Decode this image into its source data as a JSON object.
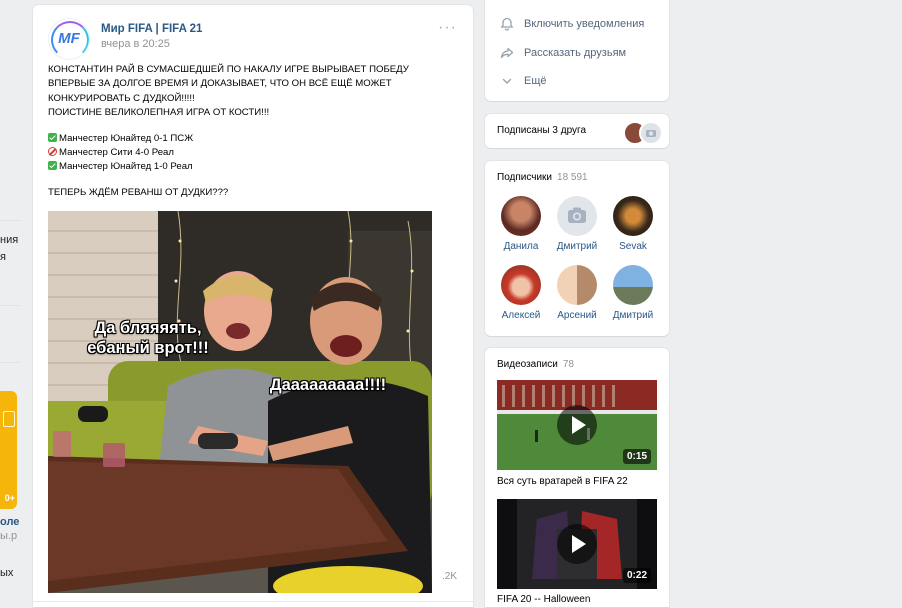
{
  "left_edge": {
    "fragment_top": "ния",
    "fragment_mid": "я",
    "fragment_group": "оле",
    "fragment_group_sub": "ы.р",
    "fragment_bottom": "ых",
    "promo_badge": "0+"
  },
  "post": {
    "author": "Мир FIFA | FIFA 21",
    "time": "вчера в 20:25",
    "avatar_text": "MF",
    "more": "···",
    "lines": [
      "КОНСТАНТИН РАЙ В СУМАСШЕДШЕЙ ПО НАКАЛУ ИГРЕ ВЫРЫВАЕТ ПОБЕДУ",
      "ВПЕРВЫЕ ЗА ДОЛГОЕ ВРЕМЯ И ДОКАЗЫВАЕТ, ЧТО ОН ВСЁ ЕЩЁ МОЖЕТ",
      "КОНКУРИРОВАТЬ С ДУДКОЙ!!!!!",
      "ПОИСТИНЕ ВЕЛИКОЛЕПНАЯ ИГРА ОТ КОСТИ!!!"
    ],
    "results": [
      {
        "icon": "check-mark-icon",
        "text": "Манчестер Юнайтед 0-1 ПСЖ"
      },
      {
        "icon": "no-entry-icon",
        "text": "Манчестер Сити 4-0 Реал"
      },
      {
        "icon": "check-mark-icon",
        "text": "Манчестер Юнайтед 1-0 Реал"
      }
    ],
    "closing": "ТЕПЕРЬ ЖДЁМ РЕВАНШ ОТ ДУДКИ???",
    "photo_caption_1": "Да бляяяять, ебаный врот!!!",
    "photo_caption_2": "Дааааааааа!!!!",
    "views": ".2K"
  },
  "actions": {
    "items": [
      {
        "label": "Включить уведомления",
        "icon": "bell-icon"
      },
      {
        "label": "Рассказать друзьям",
        "icon": "share-icon"
      },
      {
        "label": "Ещё",
        "icon": "chevron-down-icon"
      }
    ]
  },
  "friends": {
    "label": "Подписаны 3 друга"
  },
  "subscribers": {
    "title": "Подписчики",
    "count": "18 591",
    "people": [
      {
        "name": "Данила"
      },
      {
        "name": "Дмитрий"
      },
      {
        "name": "Sevak"
      },
      {
        "name": "Алексей"
      },
      {
        "name": "Арсений"
      },
      {
        "name": "Дмитрий"
      }
    ]
  },
  "videos": {
    "title": "Видеозаписи",
    "count": "78",
    "items": [
      {
        "title": "Вся суть вратарей в FIFA 22",
        "duration": "0:15"
      },
      {
        "title": "FIFA 20 -- Halloween",
        "duration": "0:22"
      }
    ]
  },
  "colors": {
    "link": "#2a5885",
    "muted": "#939393",
    "action_text": "#55677d",
    "page_bg": "#edeef0"
  }
}
